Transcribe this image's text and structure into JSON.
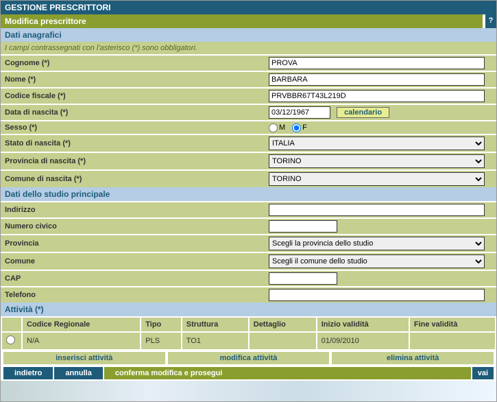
{
  "title": "GESTIONE PRESCRITTORI",
  "subtitle": "Modifica prescrittore",
  "help": "?",
  "sections": {
    "anagrafica": "Dati anagrafici",
    "studio": "Dati dello studio principale",
    "attivita": "Attività (*)"
  },
  "helper": "I campi contrassegnati con l'asterisco (*) sono obbligatori.",
  "labels": {
    "cognome": "Cognome (*)",
    "nome": "Nome (*)",
    "cf": "Codice fiscale (*)",
    "data_nascita": "Data di nascita (*)",
    "sesso": "Sesso (*)",
    "stato_nascita": "Stato di nascita (*)",
    "provincia_nascita": "Provincia di nascita (*)",
    "comune_nascita": "Comune di nascita (*)",
    "indirizzo": "Indirizzo",
    "civico": "Numero civico",
    "provincia": "Provincia",
    "comune": "Comune",
    "cap": "CAP",
    "telefono": "Telefono"
  },
  "values": {
    "cognome": "PROVA",
    "nome": "BARBARA",
    "cf": "PRVBBR67T43L219D",
    "data_nascita": "03/12/1967",
    "sesso_m": "M",
    "sesso_f": "F",
    "stato_nascita": "ITALIA",
    "provincia_nascita": "TORINO",
    "comune_nascita": "TORINO",
    "indirizzo": "",
    "civico": "",
    "provincia_studio": "Scegli la provincia dello studio",
    "comune_studio": "Scegli il comune dello studio",
    "cap": "",
    "telefono": ""
  },
  "calendario": "calendario",
  "table": {
    "headers": {
      "codice": "Codice Regionale",
      "tipo": "Tipo",
      "struttura": "Struttura",
      "dettaglio": "Dettaglio",
      "inizio": "Inizio validità",
      "fine": "Fine validità"
    },
    "row": {
      "codice": "N/A",
      "tipo": "PLS",
      "struttura": "TO1",
      "dettaglio": "",
      "inizio": "01/09/2010",
      "fine": ""
    }
  },
  "buttons": {
    "inserisci": "inserisci attività",
    "modifica": "modifica attività",
    "elimina": "elimina attività",
    "indietro": "indietro",
    "annulla": "annulla",
    "conferma": "conferma modifica e prosegui",
    "vai": "vai"
  }
}
